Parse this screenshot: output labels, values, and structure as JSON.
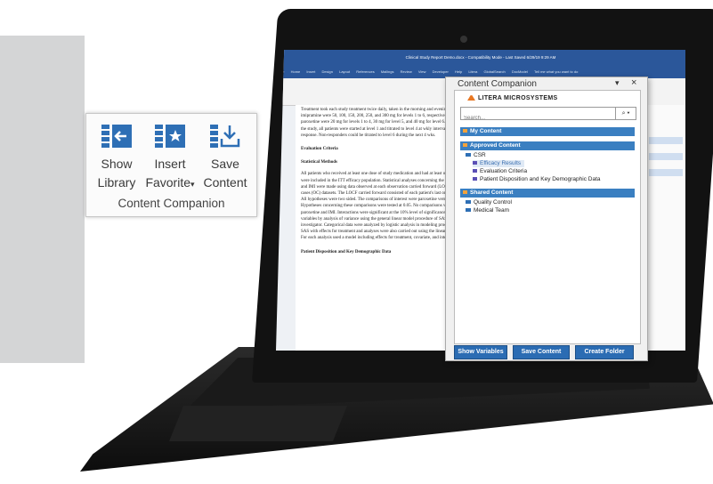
{
  "window": {
    "title": "Clinical Study Report Demo.docx  -  Compatibility Mode  -  Last Saved 6/29/19 9:29 AM",
    "tabs": [
      "File",
      "Home",
      "Insert",
      "Design",
      "Layout",
      "References",
      "Mailings",
      "Review",
      "View",
      "Developer",
      "Help",
      "Litera",
      "GlobalSearch",
      "DocModel",
      "Tell me what you want to do"
    ]
  },
  "ribbon_callout": {
    "show_library": "Show Library",
    "insert_favorite": "Insert Favorite",
    "save_content": "Save Content",
    "group_label": "Content Companion"
  },
  "document": {
    "para1": "Treatment took each study treatment twice daily, taken in the morning and evening. Daily doses of imipramine were 50, 100, 150, 200, 250, and 300 mg for levels 1 to 6, respectively. Daily doses of paroxetine were 20 mg for levels 1 to 4, 30 mg for level 5, and 40 mg for level 6. At the beginning of the study, all patients were started at level 1 and titrated to level 4 at wkly intervals, regardless of response. Non-responders could be titrated to level 6 during the next 4 wks.",
    "h1": "Evaluation Criteria",
    "h2": "Statistical Methods",
    "para2": "All patients who received at least one dose of study medication and had at least one efficacy assessment were included in the ITT efficacy population. Statistical analyses concerning the efficacy of paroxetine and IMI were made using data observed at each observation carried forward (LOCF) and observed cases (OC) datasets. The LOCF carried forward consisted of each patient's last on-therapy assessment. All hypotheses were two sided. The comparisons of interest were paroxetine versus placebo at 8 LOCF. Hypotheses concerning these comparisons were tested at 0.05. No comparisons were made between paroxetine and IMI. Interactions were significant at the 10% level of significance. Continuous efficacy variables by analysis of variance using the general linear model procedure of SAS with factors and investigator. Categorical data were analyzed by logistic analysis in modeling procedures (CATMOD) of SAS with effects for treatment and analyses were also carried out using the linear model procedures. For each analysis used a model including effects for treatment, covariate, and interaction.",
    "h3": "Patient Disposition and Key Demographic Data"
  },
  "content_companion": {
    "title": "Content Companion",
    "brand": "LITERA MICROSYSTEMS",
    "search_placeholder": "Search...",
    "sections": {
      "my_content": "My Content",
      "approved": "Approved Content",
      "shared": "Shared Content"
    },
    "approved_items": {
      "folder": "CSR",
      "items": [
        "Efficacy Results",
        "Evaluation Criteria",
        "Patient Disposition and Key Demographic Data"
      ]
    },
    "shared_items": [
      "Quality Control",
      "Medical Team"
    ],
    "buttons": {
      "show_variables": "Show Variables",
      "save_content": "Save Content",
      "create_folder": "Create Folder"
    }
  },
  "colors": {
    "word_blue": "#2b579a",
    "section_blue": "#3a7fc1",
    "button_blue": "#2b6cb3",
    "litera_orange": "#e87722"
  }
}
